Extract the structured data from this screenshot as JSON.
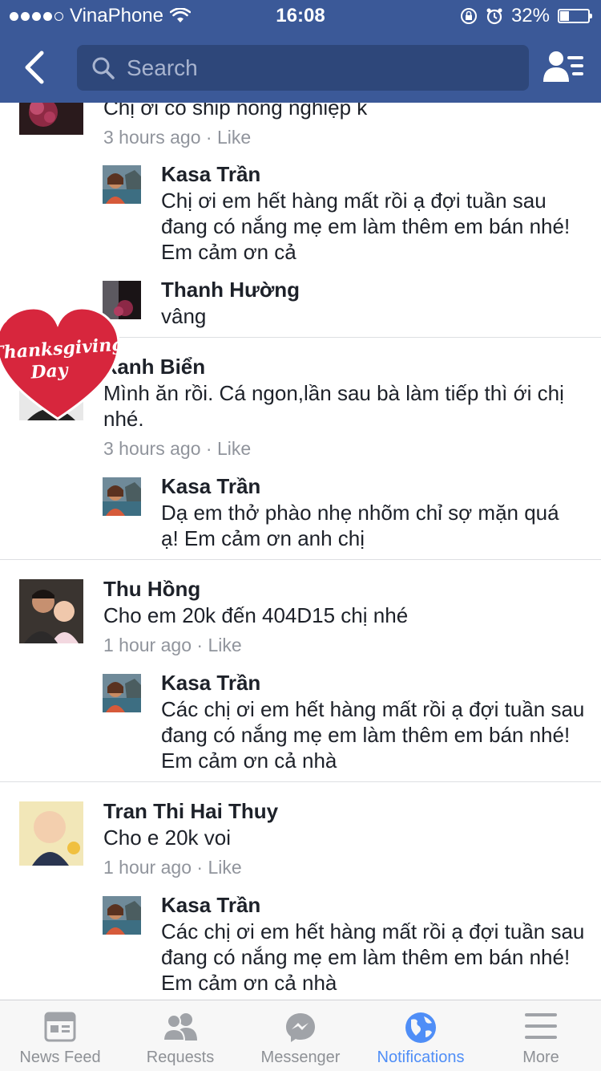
{
  "status": {
    "carrier": "VinaPhone",
    "time": "16:08",
    "battery": "32%",
    "battery_level": 0.32
  },
  "nav": {
    "search_placeholder": "Search"
  },
  "comments": [
    {
      "text": "Chị ơi có ship nông nghiệp k",
      "time": "3 hours ago",
      "like": "Like"
    },
    {
      "name": "Kasa Trần",
      "text": "Chị ơi em hết hàng mất rồi ạ đợi tuần sau đang có nắng mẹ em làm thêm em bán nhé! Em cảm ơn cả"
    },
    {
      "name": "Thanh Hường",
      "text": "vâng"
    },
    {
      "name": "Xanh Biển",
      "text": "Mình ăn rồi. Cá ngon,lần sau bà làm tiếp thì ới chị nhé.",
      "time": "3 hours ago",
      "like": "Like"
    },
    {
      "name": "Kasa Trần",
      "text": "Dạ em thở phào nhẹ nhõm chỉ sợ mặn quá ạ! Em cảm ơn anh chị"
    },
    {
      "name": "Thu Hồng",
      "text": "Cho em 20k đến 404D15 chị nhé",
      "time": "1 hour ago",
      "like": "Like"
    },
    {
      "name": "Kasa Trần",
      "text": "Các chị ơi em hết hàng mất rồi ạ đợi tuần sau đang có nắng mẹ em làm thêm em bán nhé! Em cảm ơn cả nhà"
    },
    {
      "name": "Tran Thi Hai Thuy",
      "text": "Cho e 20k voi",
      "time": "1 hour ago",
      "like": "Like"
    },
    {
      "name": "Kasa Trần",
      "text": "Các chị ơi em hết hàng mất rồi ạ đợi tuần sau đang có nắng mẹ em làm thêm em bán nhé! Em cảm ơn cả nhà"
    }
  ],
  "sticker": {
    "text_line1": "Thanksgiving",
    "text_line2": "Day"
  },
  "tabs": [
    {
      "label": "News Feed",
      "icon": "news-feed-icon"
    },
    {
      "label": "Requests",
      "icon": "friend-requests-icon"
    },
    {
      "label": "Messenger",
      "icon": "messenger-icon"
    },
    {
      "label": "Notifications",
      "icon": "globe-icon",
      "active": true
    },
    {
      "label": "More",
      "icon": "menu-icon"
    }
  ],
  "colors": {
    "brand": "#3b5998",
    "active_tab": "#4f8ef7",
    "meta": "#90949c"
  }
}
